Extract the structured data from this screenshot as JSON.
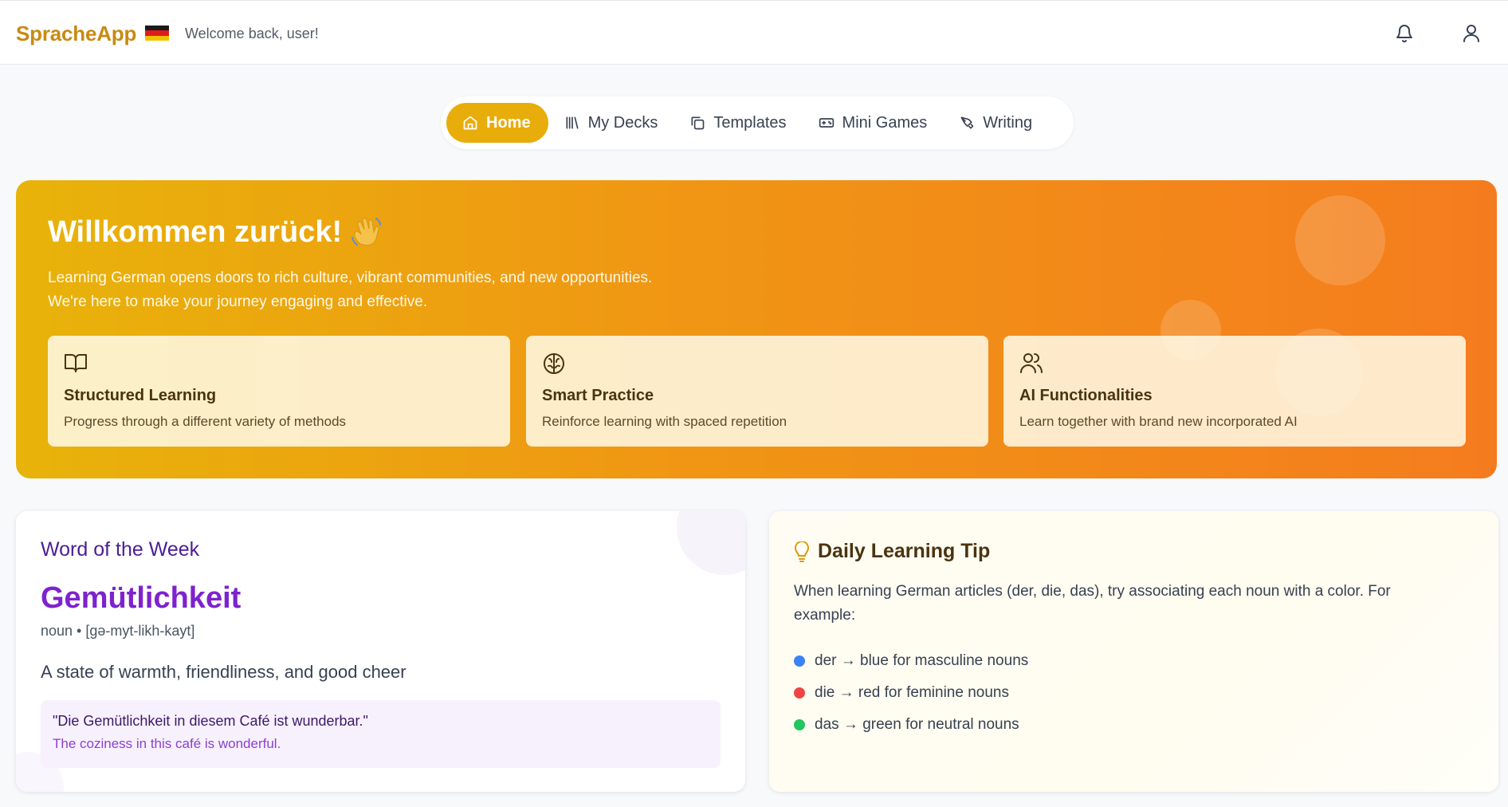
{
  "header": {
    "logo": "SpracheApp",
    "flag": "germany-flag",
    "welcome": "Welcome back, user!",
    "icons": [
      "bell-icon",
      "user-icon"
    ]
  },
  "nav": {
    "items": [
      {
        "label": "Home",
        "icon": "home-icon",
        "active": true
      },
      {
        "label": "My Decks",
        "icon": "library-icon",
        "active": false
      },
      {
        "label": "Templates",
        "icon": "copy-icon",
        "active": false
      },
      {
        "label": "Mini Games",
        "icon": "gamepad-icon",
        "active": false
      },
      {
        "label": "Writing",
        "icon": "pen-icon",
        "active": false
      }
    ]
  },
  "hero": {
    "title": "Willkommen zurück!",
    "emoji": "👋",
    "text_line1": "Learning German opens doors to rich culture, vibrant communities, and new opportunities.",
    "text_line2": "We're here to make your journey engaging and effective.",
    "features": [
      {
        "icon": "book-open-icon",
        "title": "Structured Learning",
        "desc": "Progress through a different variety of methods"
      },
      {
        "icon": "brain-icon",
        "title": "Smart Practice",
        "desc": "Reinforce learning with spaced repetition"
      },
      {
        "icon": "users-icon",
        "title": "AI Functionalities",
        "desc": "Learn together with brand new incorporated AI"
      }
    ]
  },
  "word_of_week": {
    "heading": "Word of the Week",
    "word": "Gemütlichkeit",
    "meta": "noun • [gə-myt-likh-kayt]",
    "definition": "A state of warmth, friendliness, and good cheer",
    "example_de": "\"Die Gemütlichkeit in diesem Café ist wunderbar.\"",
    "example_en": "The coziness in this café is wonderful."
  },
  "tip": {
    "icon": "lightbulb-icon",
    "title": "Daily Learning Tip",
    "text": "When learning German articles (der, die, das), try associating each noun with a color. For example:",
    "items": [
      {
        "text": "der → blue for masculine nouns",
        "color": "#3b82f6"
      },
      {
        "text": "die → red for feminine nouns",
        "color": "#ef4444"
      },
      {
        "text": "das → green for neutral nouns",
        "color": "#22c55e"
      }
    ]
  },
  "colors": {
    "brand": "#c98a12",
    "nav_active": "#e8ad0b",
    "hero_start": "#e8b30a",
    "hero_end": "#f57c1e",
    "word_purple": "#7e22ce"
  }
}
